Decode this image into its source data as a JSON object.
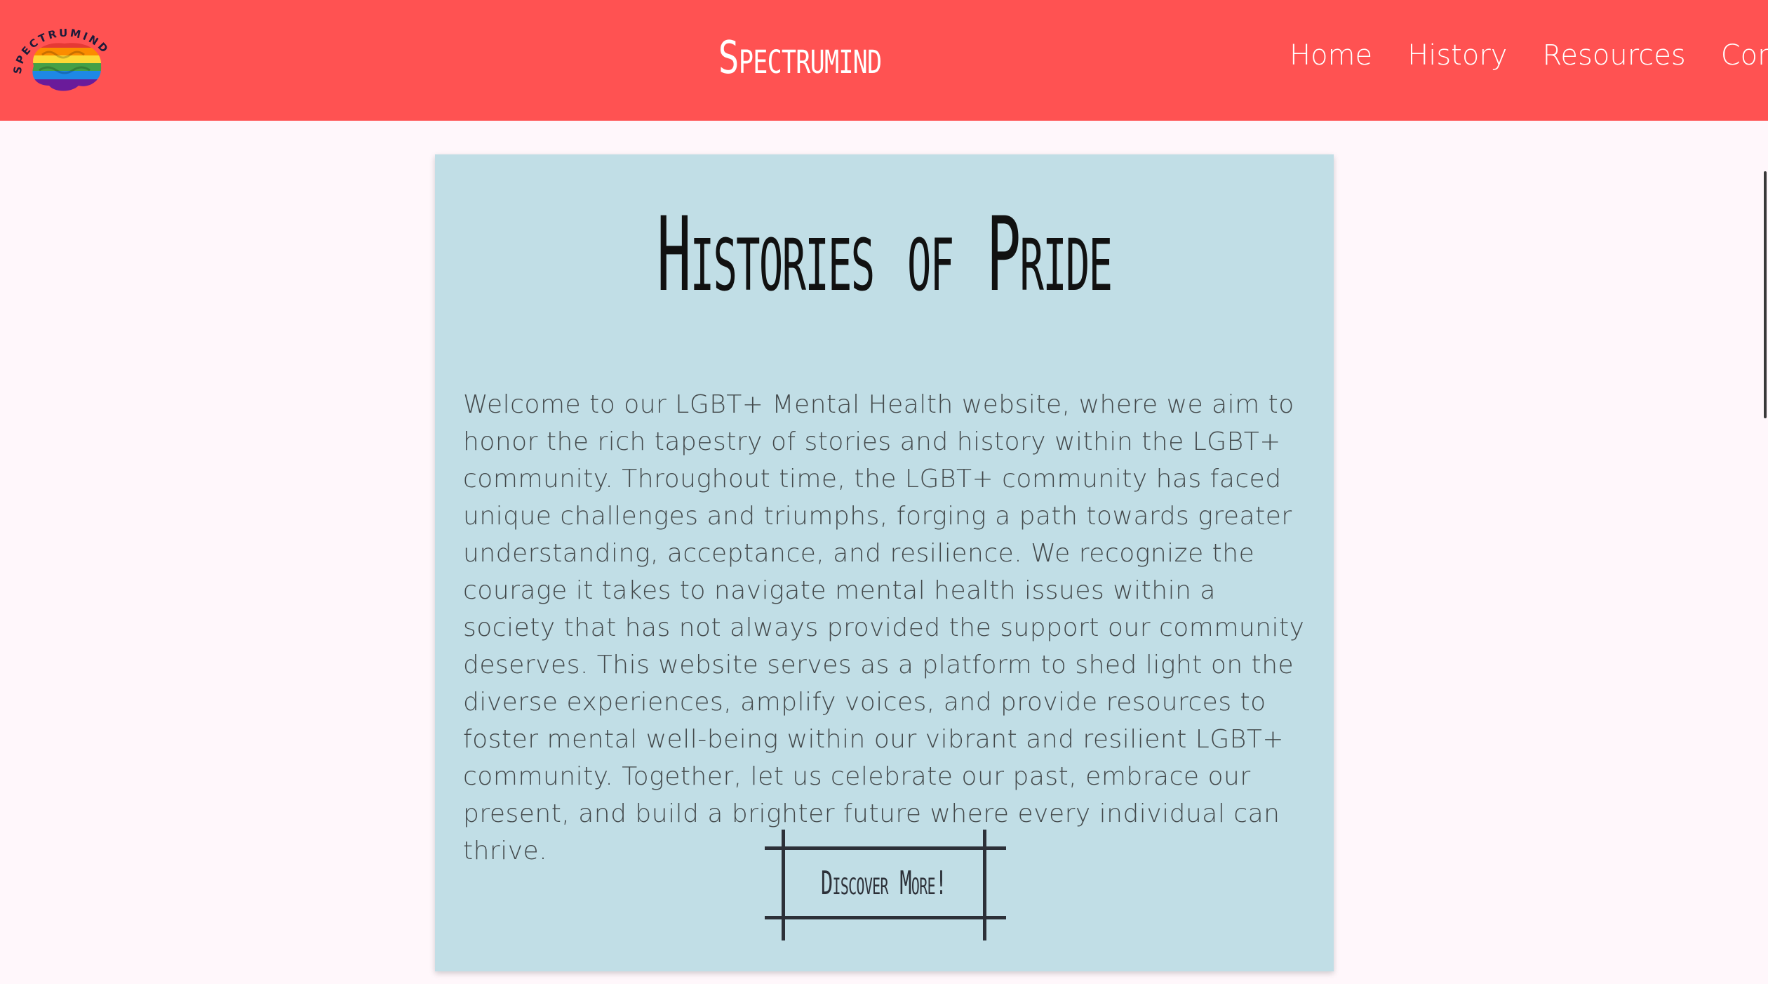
{
  "header": {
    "logo_text": "SPECTRUMIND",
    "site_title": "Spectrumind",
    "nav": [
      {
        "label": "Home"
      },
      {
        "label": "History"
      },
      {
        "label": "Resources"
      },
      {
        "label": "Contact"
      }
    ]
  },
  "main": {
    "title": "Histories of Pride",
    "body": "Welcome to our LGBT+ Mental Health website, where we aim to honor the rich tapestry of stories and history within the LGBT+ community. Throughout time, the LGBT+ community has faced unique challenges and triumphs, forging a path towards greater understanding, acceptance, and resilience. We recognize the courage it takes to navigate mental health issues within a society that has not always provided the support our community deserves. This website serves as a platform to shed light on the diverse experiences, amplify voices, and provide resources to foster mental well-being within our vibrant and resilient LGBT+ community. Together, let us celebrate our past, embrace our present, and build a brighter future where every individual can thrive.",
    "cta_label": "Discover More!"
  },
  "colors": {
    "header_bg": "#ff5252",
    "page_bg": "#fff7fb",
    "card_bg": "#c1dee6",
    "text": "#444a4c",
    "frame": "#2c3038"
  },
  "icons": {
    "logo": "rainbow-brain-icon"
  }
}
